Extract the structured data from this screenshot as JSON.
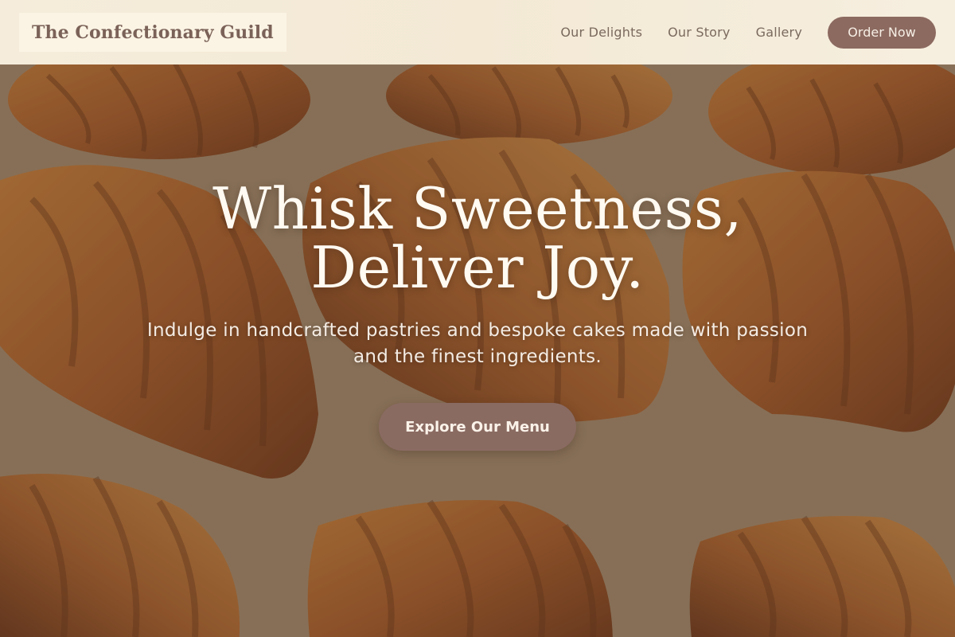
{
  "header": {
    "brand": "The Confectionary Guild",
    "nav": [
      {
        "label": "Our Delights"
      },
      {
        "label": "Our Story"
      },
      {
        "label": "Gallery"
      }
    ],
    "cta_label": "Order Now"
  },
  "hero": {
    "title_line1": "Whisk Sweetness,",
    "title_line2": "Deliver Joy.",
    "subtitle": "Indulge in handcrafted pastries and bespoke cakes made with passion and the finest ingredients.",
    "button_label": "Explore Our Menu",
    "background": "croissants-photo"
  },
  "colors": {
    "accent": "#8c6a60",
    "header_bg": "#f3e9d5",
    "brand_text": "#7b6258",
    "nav_text": "#7a6a5e"
  }
}
